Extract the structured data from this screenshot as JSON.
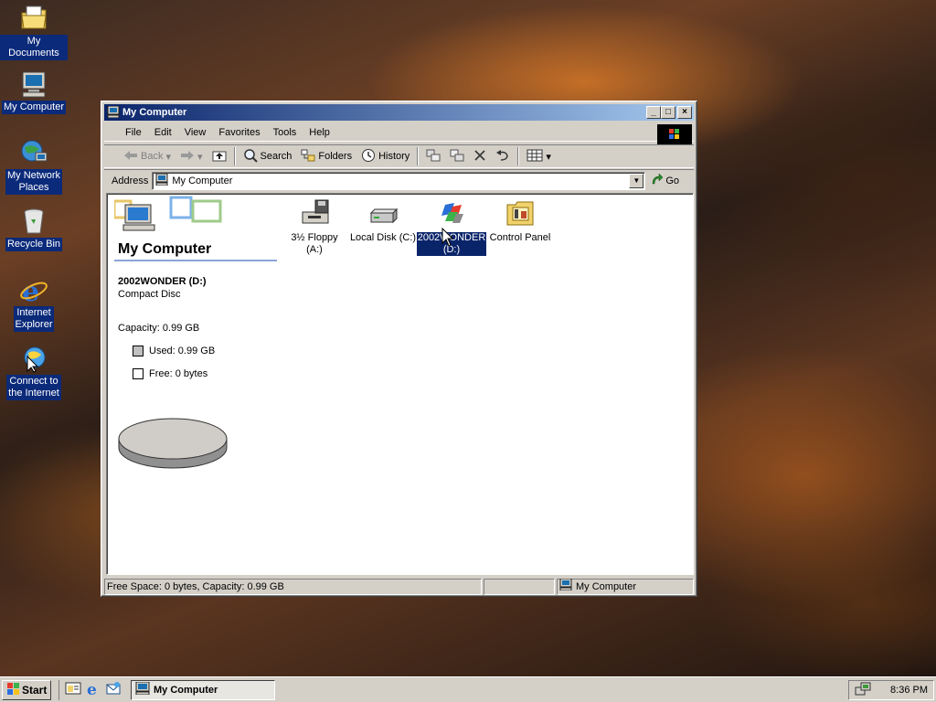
{
  "desktop": {
    "icons": [
      {
        "label": "My Documents",
        "icon": "folder-documents-icon"
      },
      {
        "label": "My Computer",
        "icon": "computer-icon"
      },
      {
        "label_line1": "My Network",
        "label_line2": "Places",
        "icon": "network-places-icon"
      },
      {
        "label": "Recycle Bin",
        "icon": "recycle-bin-icon"
      },
      {
        "label_line1": "Internet",
        "label_line2": "Explorer",
        "icon": "internet-explorer-icon"
      },
      {
        "label_line1": "Connect to",
        "label_line2": "the Internet",
        "icon": "connect-internet-icon"
      }
    ]
  },
  "window": {
    "title": "My Computer",
    "menu": [
      "File",
      "Edit",
      "View",
      "Favorites",
      "Tools",
      "Help"
    ],
    "toolbar": {
      "back": "Back",
      "search": "Search",
      "folders": "Folders",
      "history": "History"
    },
    "address": {
      "label": "Address",
      "value": "My Computer",
      "go": "Go"
    },
    "left_pane": {
      "title": "My Computer",
      "drive_name": "2002WONDER (D:)",
      "drive_type": "Compact Disc",
      "capacity": "Capacity: 0.99 GB",
      "used": "Used: 0.99 GB",
      "free": "Free: 0 bytes"
    },
    "items": [
      {
        "line1": "3½ Floppy",
        "line2": "(A:)",
        "icon": "floppy-drive-icon"
      },
      {
        "line1": "Local Disk (C:)",
        "line2": "",
        "icon": "hard-disk-icon"
      },
      {
        "line1": "2002WONDER",
        "line2": "(D:)",
        "icon": "cd-drive-icon",
        "selected": true
      },
      {
        "line1": "Control Panel",
        "line2": "",
        "icon": "control-panel-icon"
      }
    ],
    "status": {
      "left": "Free Space: 0 bytes, Capacity: 0.99 GB",
      "right": "My Computer"
    }
  },
  "taskbar": {
    "start": "Start",
    "task": "My Computer",
    "clock": "8:36 PM"
  },
  "colors": {
    "selection": "#0a246a",
    "titlebar_start": "#0a246a",
    "titlebar_end": "#a6caf0",
    "face": "#d4d0c8",
    "used_swatch": "#c0c0c0"
  }
}
